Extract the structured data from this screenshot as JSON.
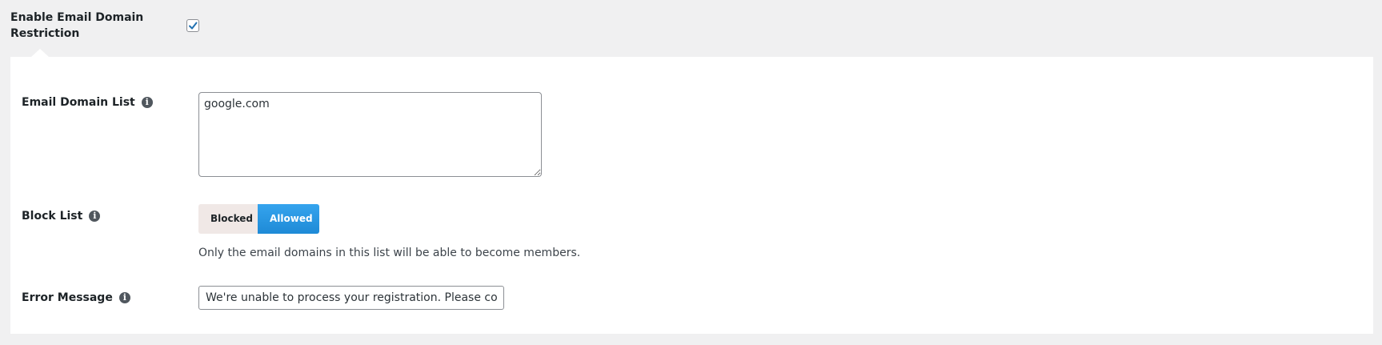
{
  "top": {
    "enable_label": "Enable Email Domain Restriction",
    "enabled": true
  },
  "fields": {
    "domain_list": {
      "label": "Email Domain List",
      "value": "google.com"
    },
    "block_list": {
      "label": "Block List",
      "options": [
        "Blocked",
        "Allowed"
      ],
      "selected": "Allowed",
      "help": "Only the email domains in this list will be able to become members."
    },
    "error_message": {
      "label": "Error Message",
      "value": "We're unable to process your registration. Please contact"
    }
  },
  "icons": {
    "info": "info-icon",
    "checkbox": "checkmark-icon"
  },
  "colors": {
    "accent": "#2196e3",
    "panel_bg": "#ffffff",
    "page_bg": "#f0f0f1"
  }
}
